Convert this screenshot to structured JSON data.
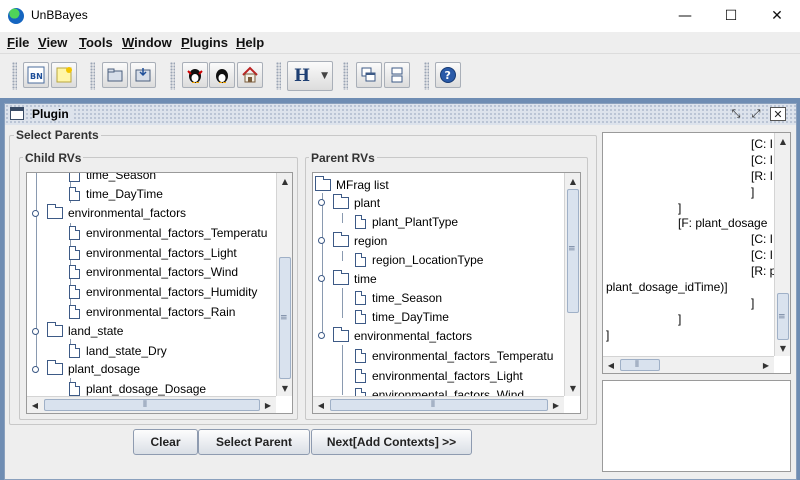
{
  "window": {
    "title": "UnBBayes"
  },
  "window_controls": {
    "minimize": "—",
    "maximize": "☐",
    "close": "✕"
  },
  "menu": [
    "File",
    "View",
    "Tools",
    "Window",
    "Plugins",
    "Help"
  ],
  "toolbar": {
    "buttons": [
      "new-bn-icon",
      "new-note-icon",
      "open-file-icon",
      "save-file-icon",
      "linux-penguin-icon",
      "penguin-icon",
      "home-icon",
      "h-dropdown-icon",
      "cascade-windows-icon",
      "tile-windows-icon",
      "help-icon"
    ],
    "h_label": "H"
  },
  "frame": {
    "title": "Plugin"
  },
  "select_parents": {
    "title": "Select Parents"
  },
  "child_rvs": {
    "title": "Child RVs",
    "items": [
      "time_Season",
      "time_DayTime",
      "environmental_factors",
      "environmental_factors_Temperatu",
      "environmental_factors_Light",
      "environmental_factors_Wind",
      "environmental_factors_Humidity",
      "environmental_factors_Rain",
      "land_state",
      "land_state_Dry",
      "plant_dosage",
      "plant_dosage_Dosage"
    ]
  },
  "parent_rvs": {
    "title": "Parent RVs",
    "items": [
      "MFrag list",
      "plant",
      "plant_PlantType",
      "region",
      "region_LocationType",
      "time",
      "time_Season",
      "time_DayTime",
      "environmental_factors",
      "environmental_factors_Temperatu",
      "environmental_factors_Light",
      "environmental_factors_Wind"
    ]
  },
  "buttons": {
    "clear": "Clear",
    "select_parent": "Select Parent",
    "next": "Next[Add Contexts] >>"
  },
  "right_text": {
    "l1": "[C: I",
    "l2": "[C: I",
    "l3": "[R: I",
    "l4": "]",
    "l5": "]",
    "l6": "[F: plant_dosage",
    "l7": "[C: I",
    "l8": "[C: I",
    "l9": "[R: p",
    "l10": "plant_dosage_idTime)]",
    "l11": "]",
    "l12": "]",
    "l13": "]"
  },
  "colors": {
    "desktop": "#6f8db3",
    "frame_bg": "#eeeeee",
    "thumb": "#d9e2ee"
  }
}
